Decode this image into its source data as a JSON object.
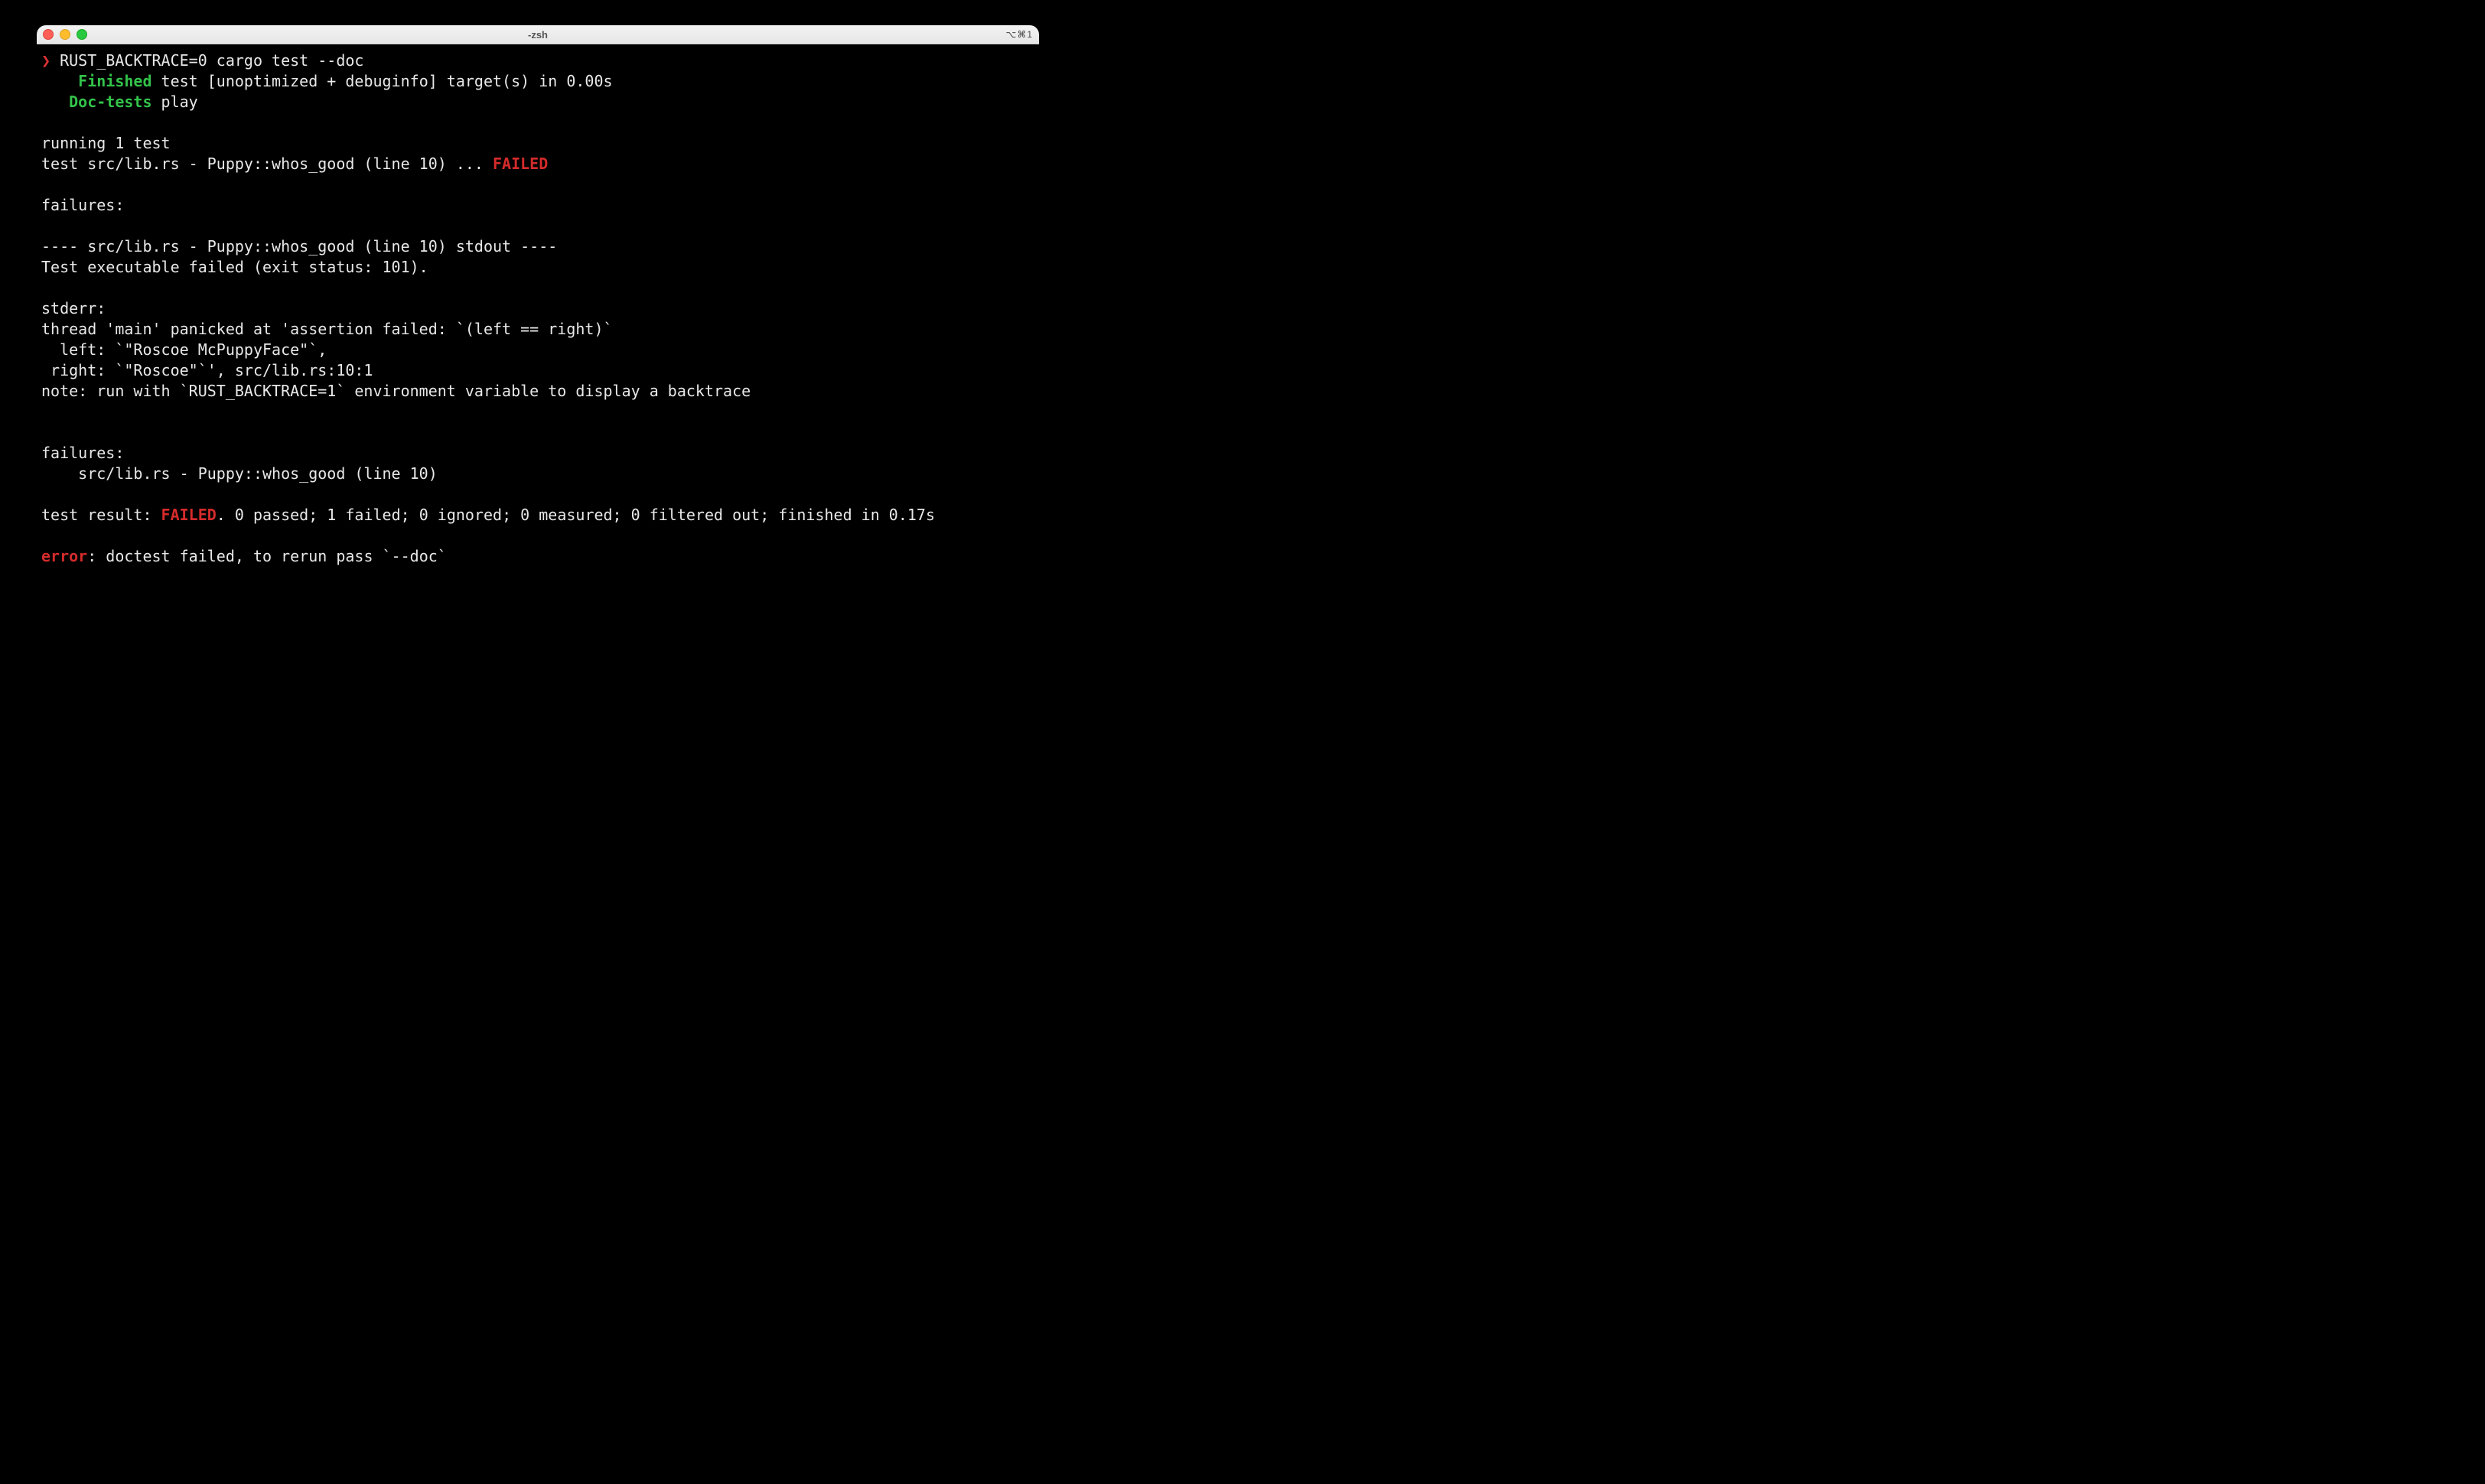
{
  "window": {
    "title": "-zsh",
    "shortcut": "⌥⌘1"
  },
  "prompt": {
    "symbol": "❯",
    "command": "RUST_BACKTRACE=0 cargo test --doc"
  },
  "lines": {
    "finished_label": "Finished",
    "finished_rest": " test [unoptimized + debuginfo] target(s) in 0.00s",
    "doctests_label": "Doc-tests",
    "doctests_rest": " play",
    "running": "running 1 test",
    "test_pre": "test src/lib.rs - Puppy::whos_good (line 10) ... ",
    "test_status": "FAILED",
    "failures_hdr": "failures:",
    "stdout_hdr": "---- src/lib.rs - Puppy::whos_good (line 10) stdout ----",
    "exec_failed": "Test executable failed (exit status: 101).",
    "stderr_hdr": "stderr:",
    "panic": "thread 'main' panicked at 'assertion failed: `(left == right)`",
    "left": "  left: `\"Roscoe McPuppyFace\"`,",
    "right": " right: `\"Roscoe\"`', src/lib.rs:10:1",
    "note": "note: run with `RUST_BACKTRACE=1` environment variable to display a backtrace",
    "failures2_hdr": "failures:",
    "failures2_item": "    src/lib.rs - Puppy::whos_good (line 10)",
    "result_pre": "test result: ",
    "result_status": "FAILED",
    "result_post": ". 0 passed; 1 failed; 0 ignored; 0 measured; 0 filtered out; finished in 0.17s",
    "error_label": "error",
    "error_rest": ": doctest failed, to rerun pass `--doc`"
  }
}
